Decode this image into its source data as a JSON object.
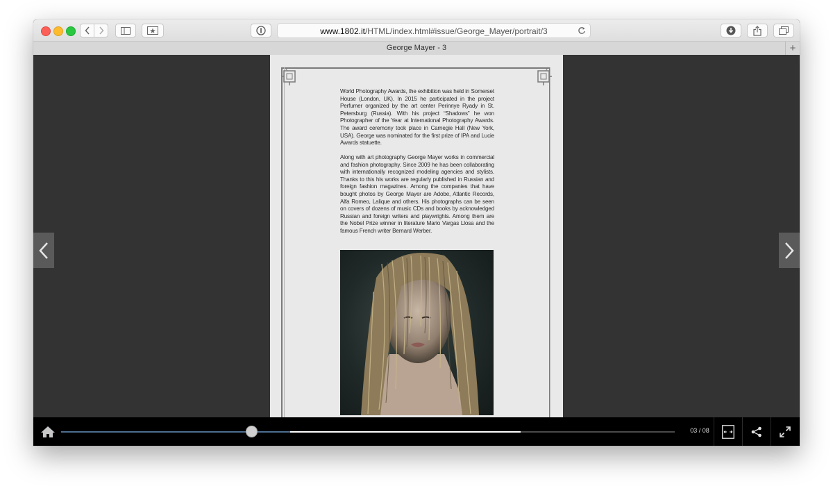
{
  "browser": {
    "url_host": "www.1802.it",
    "url_path": "/HTML/index.html#issue/George_Mayer/portrait/3",
    "tab_title": "George Mayer - 3",
    "new_tab_label": "+"
  },
  "article": {
    "paragraphs": [
      "World Photography Awards, the exhibition was held in Somerset House (London, UK). In 2015 he participated in the project Perfumer organized by the art center Perinnye Ryady in St. Petersburg (Russia). With his project “Shadows” he won Photographer of the Year at International Photography Awards. The award ceremony took place in Carnegie Hall (New York, USA). George was nominated for the first prize of IPA and Lucie Awards statuette.",
      "Along with art photography George Mayer works in commercial and fashion photography. Since 2009 he has been collaborating with internationally recognized modeling agencies and stylists. Thanks to this his works are regularly published in Russian and foreign fashion magazines. Among the companies that have bought photos by George Mayer are Adobe, Atlantic Records, Alfa Romeo, Lalique and others. His photographs can be seen on covers of dozens of music CDs and books by acknowledged Russian and foreign writers and playwrights. Among them are the Nobel Prize winner in literature Mario Vargas Llosa and the famous French writer Bernard Werber."
    ]
  },
  "viewer": {
    "page_indicator": "03 / 08",
    "progress_fraction": 0.31,
    "current_page": 3,
    "total_pages": 8
  },
  "icons": {
    "home": "home-icon",
    "fit_width": "fit-width-icon",
    "share": "share-icon",
    "fullscreen": "fullscreen-icon",
    "prev": "chevron-left-icon",
    "next": "chevron-right-icon"
  },
  "colors": {
    "accent": "#4d6f92",
    "viewer_background": "#333333",
    "bottom_bar": "#000000"
  }
}
